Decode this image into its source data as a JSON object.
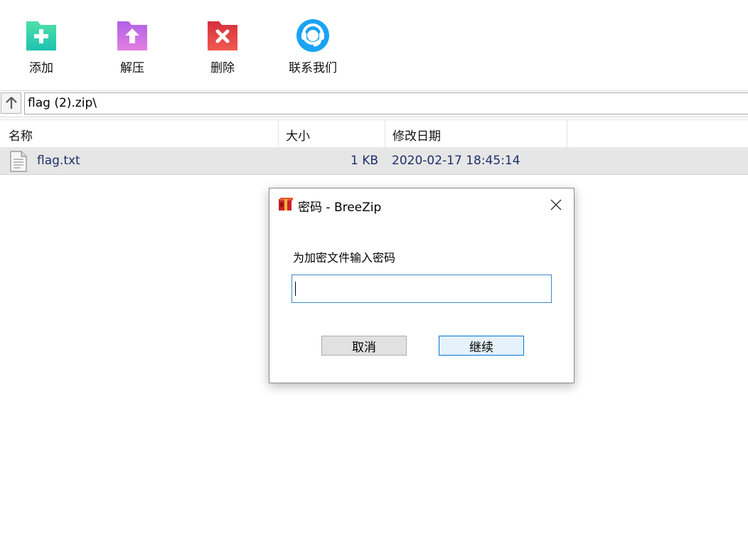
{
  "toolbar": {
    "items": [
      {
        "label": "添加",
        "icon": "add-folder-icon",
        "color": "#2ecfa5"
      },
      {
        "label": "解压",
        "icon": "extract-folder-icon",
        "color": "#c268e8"
      },
      {
        "label": "删除",
        "icon": "delete-folder-icon",
        "color": "#e43f4a"
      },
      {
        "label": "联系我们",
        "icon": "support-headset-icon",
        "color": "#1aa3f5"
      }
    ]
  },
  "address": {
    "path": "flag (2).zip\\"
  },
  "list": {
    "columns": [
      "名称",
      "大小",
      "修改日期"
    ],
    "rows": [
      {
        "name": "flag.txt",
        "size": "1 KB",
        "modified": "2020-02-17 18:45:14"
      }
    ]
  },
  "dialog": {
    "title": "密码 - BreeZip",
    "prompt": "为加密文件输入密码",
    "password_value": "",
    "cancel_label": "取消",
    "continue_label": "继续"
  },
  "colors": {
    "selected_row": "#e6e6e6",
    "row_text": "#1f2f6a",
    "focus_border": "#3c87d2"
  }
}
